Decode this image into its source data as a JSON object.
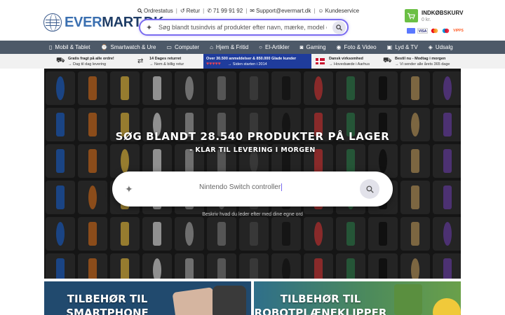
{
  "logo": {
    "part1": "EVER",
    "part2": "MART.DK"
  },
  "top_links": [
    {
      "icon": "search-icon",
      "label": "Ordrestatus"
    },
    {
      "icon": "return-icon",
      "label": "Retur"
    },
    {
      "icon": "phone-icon",
      "label": "71 99 91 92"
    },
    {
      "icon": "mail-icon",
      "label": "Support@evermart.dk"
    },
    {
      "icon": "support-icon",
      "label": "Kundeservice"
    }
  ],
  "search": {
    "placeholder": "Søg blandt tusindvis af produkter efter navn, mærke, model eller beskrivelse"
  },
  "cart": {
    "label": "INDKØBSKURV",
    "sum": "0 kr."
  },
  "payments": [
    "MobilePay",
    "VISA",
    "Mastercard",
    "Maestro",
    "VIPPS"
  ],
  "nav": [
    {
      "icon": "phone-icon",
      "label": "Mobil & Tablet"
    },
    {
      "icon": "watch-icon",
      "label": "Smartwatch & Ure"
    },
    {
      "icon": "laptop-icon",
      "label": "Computer"
    },
    {
      "icon": "home-icon",
      "label": "Hjem & Fritid"
    },
    {
      "icon": "bulb-icon",
      "label": "El-Artikler"
    },
    {
      "icon": "gamepad-icon",
      "label": "Gaming"
    },
    {
      "icon": "camera-icon",
      "label": "Foto & Video"
    },
    {
      "icon": "speaker-icon",
      "label": "Lyd & TV"
    },
    {
      "icon": "tag-icon",
      "label": "Udsalg"
    }
  ],
  "usp": [
    {
      "icon": "truck-icon",
      "t1": "Gratis fragt på alle ordre!",
      "t2": "→ Dag til dag levering"
    },
    {
      "icon": "return-box-icon",
      "t1": "14 Dages returret",
      "t2": "→ Nem & billig retur"
    },
    {
      "icon": "hearts-icon",
      "t1": "Over 30.500 anmeldelser & 850.000 Glade kunder",
      "t2": "→ Siden starten i 2014"
    },
    {
      "icon": "danish-flag-icon",
      "t1": "Dansk virksomhed",
      "t2": "→ Hovedsæde i Aarhus"
    },
    {
      "icon": "delivery-truck-icon",
      "t1": "Bestil nu - Modtag i morgen",
      "t2": "→ Vi sender alle årets 365 dage"
    }
  ],
  "hero": {
    "title": "SØG BLANDT 28.540 PRODUKTER PÅ LAGER",
    "subtitle": "- KLAR TIL LEVERING I MORGEN",
    "search_value": "Nintendo Switch controller",
    "hint": "Beskriv hvad du leder efter med dine egne ord"
  },
  "banners": [
    {
      "title": "TILBEHØR TIL SMARTPHONE"
    },
    {
      "title": "TILBEHØR TIL ROBOTPLÆNEKLIPPER"
    }
  ],
  "colors": {
    "nav_bg": "#4d5968",
    "search_border": "#7a6cf0",
    "cart_green": "#6bbf44",
    "usp_blue": "#1f3c9c",
    "logo_light": "#3a6fb0",
    "logo_dark": "#1f3d66"
  }
}
